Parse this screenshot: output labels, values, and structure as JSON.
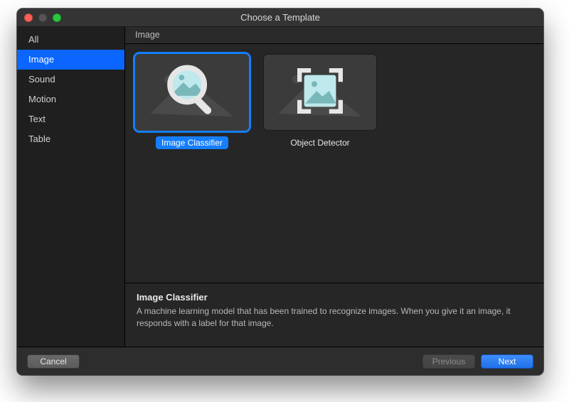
{
  "window": {
    "title": "Choose a Template"
  },
  "sidebar": {
    "items": [
      {
        "label": "All"
      },
      {
        "label": "Image"
      },
      {
        "label": "Sound"
      },
      {
        "label": "Motion"
      },
      {
        "label": "Text"
      },
      {
        "label": "Table"
      }
    ],
    "selected_index": 1
  },
  "section": {
    "header": "Image"
  },
  "templates": [
    {
      "label": "Image Classifier",
      "selected": true,
      "icon": "magnifier-icon"
    },
    {
      "label": "Object Detector",
      "selected": false,
      "icon": "crop-frame-icon"
    }
  ],
  "description": {
    "title": "Image Classifier",
    "text": "A machine learning model that has been trained to recognize images. When you give it an image, it responds with a label for that image."
  },
  "footer": {
    "cancel": "Cancel",
    "previous": "Previous",
    "next": "Next"
  },
  "colors": {
    "accent": "#157efb",
    "window_bg": "#262626",
    "sidebar_bg": "#1f1f1f"
  }
}
